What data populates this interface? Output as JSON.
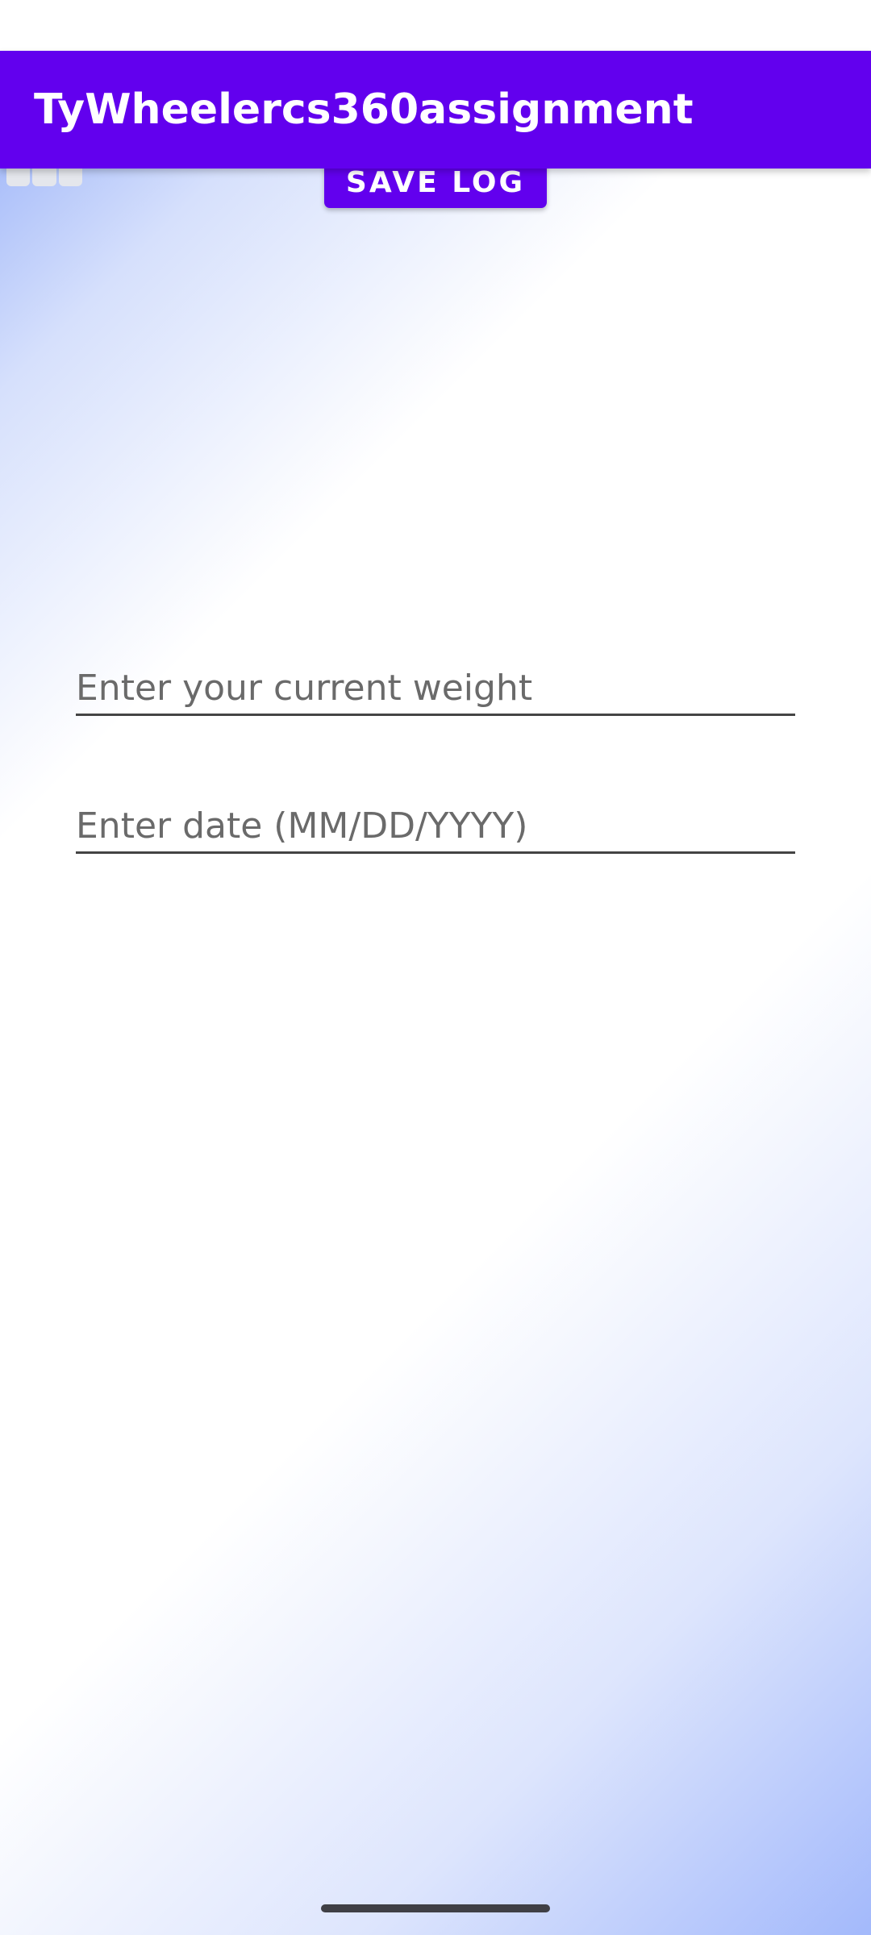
{
  "app_bar": {
    "title": "TyWheelercs360assignment",
    "color": "#6200ee"
  },
  "toolbar": {
    "save_label": "SAVE LOG",
    "menu_icon": "grid-icon"
  },
  "form": {
    "weight": {
      "value": "",
      "placeholder": "Enter your current weight"
    },
    "date": {
      "value": "",
      "placeholder": "Enter date (MM/DD/YYYY)"
    }
  },
  "theme": {
    "accent": "#6200ee",
    "gradient_blue": "#8aa6f7",
    "background": "#ffffff"
  }
}
